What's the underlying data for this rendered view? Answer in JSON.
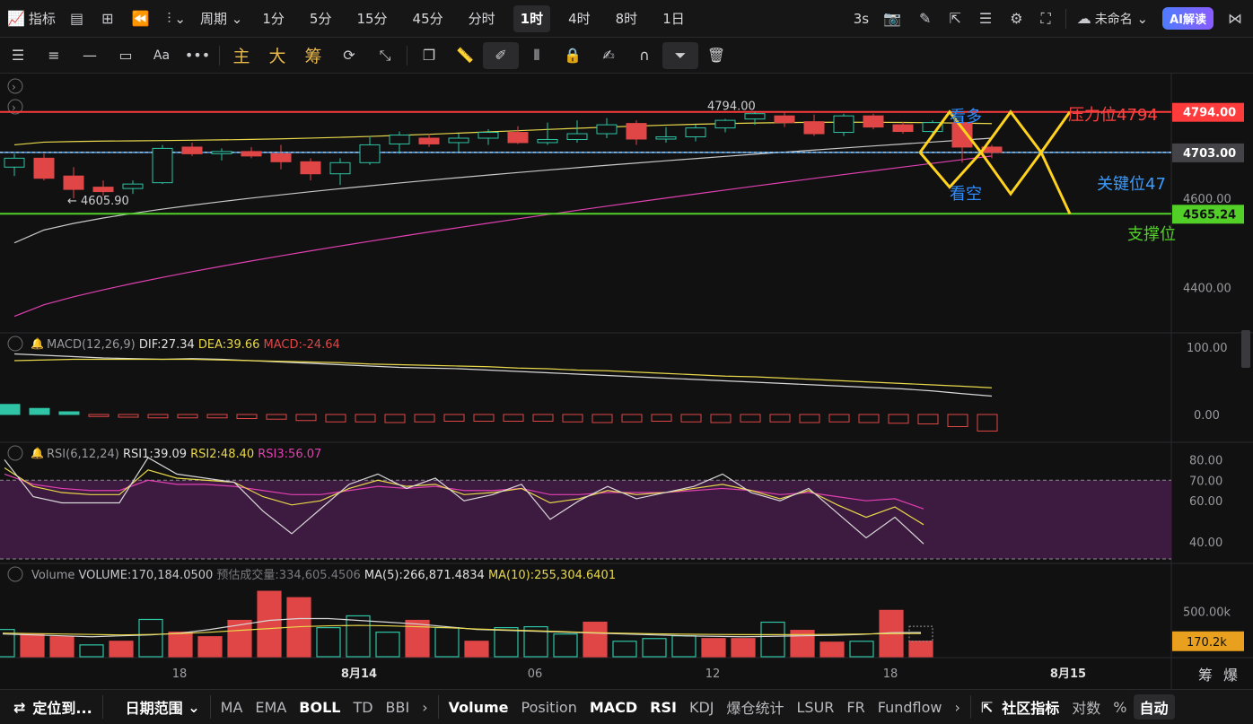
{
  "topbar": {
    "indicator_label": "指标",
    "period_label": "周期",
    "intervals": [
      "1分",
      "5分",
      "15分",
      "45分",
      "分时",
      "1时",
      "4时",
      "8时",
      "1日"
    ],
    "active_interval": "1时",
    "refresh_label": "3s",
    "workspace_name": "未命名",
    "ai_label": "AI解读"
  },
  "toolbar": {
    "main_label": "主",
    "big_label": "大",
    "chip_label": "筹"
  },
  "colors": {
    "up": "#2ec4a5",
    "down": "#e04646",
    "ma_yellow": "#e8d84a",
    "ma_white": "#c8c8c8",
    "ma_pink": "#e040b0",
    "resistance": "#ff3b3b",
    "support": "#52d028",
    "key": "#4aa8ff",
    "zigzag": "#ffd21e",
    "annotation_blue": "#2e8cff"
  },
  "chart_data": [
    {
      "type": "candlestick",
      "panel": "price",
      "y_axis_ticks": [
        4600,
        4400
      ],
      "price_tags": [
        4794.0,
        4703.0,
        4565.24
      ],
      "high_label": "4794.00",
      "low_label": "← 4605.90",
      "candles": [
        {
          "o": 4670,
          "h": 4700,
          "l": 4650,
          "c": 4690
        },
        {
          "o": 4690,
          "h": 4700,
          "l": 4640,
          "c": 4645
        },
        {
          "o": 4650,
          "h": 4670,
          "l": 4600,
          "c": 4620
        },
        {
          "o": 4625,
          "h": 4640,
          "l": 4605.9,
          "c": 4615
        },
        {
          "o": 4622,
          "h": 4640,
          "l": 4610,
          "c": 4632
        },
        {
          "o": 4635,
          "h": 4720,
          "l": 4632,
          "c": 4712
        },
        {
          "o": 4715,
          "h": 4725,
          "l": 4695,
          "c": 4700
        },
        {
          "o": 4700,
          "h": 4712,
          "l": 4685,
          "c": 4705
        },
        {
          "o": 4705,
          "h": 4715,
          "l": 4690,
          "c": 4695
        },
        {
          "o": 4700,
          "h": 4720,
          "l": 4665,
          "c": 4682
        },
        {
          "o": 4682,
          "h": 4690,
          "l": 4640,
          "c": 4655
        },
        {
          "o": 4655,
          "h": 4690,
          "l": 4630,
          "c": 4680
        },
        {
          "o": 4680,
          "h": 4740,
          "l": 4675,
          "c": 4720
        },
        {
          "o": 4722,
          "h": 4750,
          "l": 4700,
          "c": 4742
        },
        {
          "o": 4735,
          "h": 4745,
          "l": 4715,
          "c": 4722
        },
        {
          "o": 4725,
          "h": 4745,
          "l": 4705,
          "c": 4735
        },
        {
          "o": 4735,
          "h": 4755,
          "l": 4720,
          "c": 4748
        },
        {
          "o": 4748,
          "h": 4762,
          "l": 4722,
          "c": 4725
        },
        {
          "o": 4725,
          "h": 4770,
          "l": 4720,
          "c": 4732
        },
        {
          "o": 4732,
          "h": 4775,
          "l": 4725,
          "c": 4745
        },
        {
          "o": 4745,
          "h": 4780,
          "l": 4735,
          "c": 4765
        },
        {
          "o": 4768,
          "h": 4775,
          "l": 4720,
          "c": 4733
        },
        {
          "o": 4733,
          "h": 4760,
          "l": 4725,
          "c": 4738
        },
        {
          "o": 4738,
          "h": 4765,
          "l": 4728,
          "c": 4758
        },
        {
          "o": 4758,
          "h": 4778,
          "l": 4748,
          "c": 4775
        },
        {
          "o": 4778,
          "h": 4794,
          "l": 4765,
          "c": 4790
        },
        {
          "o": 4785,
          "h": 4794,
          "l": 4760,
          "c": 4770
        },
        {
          "o": 4772,
          "h": 4788,
          "l": 4740,
          "c": 4745
        },
        {
          "o": 4748,
          "h": 4790,
          "l": 4740,
          "c": 4785
        },
        {
          "o": 4785,
          "h": 4790,
          "l": 4755,
          "c": 4760
        },
        {
          "o": 4765,
          "h": 4772,
          "l": 4745,
          "c": 4750
        },
        {
          "o": 4750,
          "h": 4775,
          "l": 4740,
          "c": 4770
        },
        {
          "o": 4770,
          "h": 4780,
          "l": 4680,
          "c": 4715
        },
        {
          "o": 4715,
          "h": 4720,
          "l": 4690,
          "c": 4703
        }
      ],
      "levels": {
        "resistance": 4794.0,
        "key": 4703.0,
        "support": 4565.24
      },
      "annotations": {
        "bull": "看多",
        "bear": "看空",
        "resistance_text": "压力位4794",
        "key_text": "关键位47",
        "support_text": "支撑位"
      }
    },
    {
      "type": "bar+line",
      "panel": "macd",
      "title": "MACD(12,26,9)",
      "dif_label": "DIF:27.34",
      "dea_label": "DEA:39.66",
      "macd_label": "MACD:-24.64",
      "y_axis_ticks": [
        "100.00",
        "0.00"
      ],
      "hist": [
        15,
        9,
        4,
        -3,
        -4,
        -5,
        -5,
        -5,
        -6,
        -7,
        -9,
        -11,
        -11,
        -12,
        -11,
        -10,
        -10,
        -10,
        -10,
        -11,
        -12,
        -11,
        -10,
        -11,
        -12,
        -11,
        -11,
        -12,
        -11,
        -12,
        -13,
        -14,
        -18,
        -24.64
      ],
      "dif": [
        90,
        88,
        86,
        84,
        83,
        82,
        83,
        82,
        80,
        78,
        76,
        74,
        72,
        70,
        69,
        68,
        66,
        64,
        62,
        60,
        58,
        56,
        54,
        52,
        50,
        48,
        46,
        44,
        42,
        40,
        38,
        35,
        31,
        27.34
      ],
      "dea": [
        80,
        81,
        82,
        82,
        82,
        82,
        82,
        81,
        80,
        79,
        78,
        77,
        75,
        74,
        73,
        72,
        71,
        69,
        68,
        66,
        65,
        63,
        61,
        59,
        57,
        56,
        54,
        52,
        50,
        48,
        46,
        44,
        42,
        39.66
      ]
    },
    {
      "type": "line",
      "panel": "rsi",
      "title": "RSI(6,12,24)",
      "rsi1_label": "RSI1:39.09",
      "rsi2_label": "RSI2:48.40",
      "rsi3_label": "RSI3:56.07",
      "y_axis_ticks": [
        "80.00",
        "70.00",
        "60.00",
        "40.00"
      ],
      "rsi1": [
        80,
        62,
        59,
        59,
        59,
        81,
        73,
        71,
        69,
        55,
        44,
        56,
        68,
        73,
        66,
        71,
        60,
        63,
        68,
        51,
        60,
        67,
        61,
        64,
        67,
        73,
        64,
        60,
        66,
        54,
        42,
        52,
        39.09
      ],
      "rsi2": [
        76,
        67,
        64,
        63,
        63,
        75,
        71,
        70,
        69,
        62,
        58,
        60,
        66,
        70,
        67,
        68,
        63,
        64,
        66,
        59,
        61,
        65,
        63,
        64,
        66,
        68,
        65,
        61,
        65,
        58,
        52,
        57,
        48.4
      ],
      "rsi3": [
        73,
        68,
        66,
        65,
        65,
        70,
        68,
        68,
        67,
        65,
        63,
        63,
        65,
        67,
        66,
        67,
        65,
        65,
        66,
        63,
        63,
        64,
        64,
        64,
        65,
        66,
        65,
        63,
        64,
        62,
        60,
        61,
        56.07
      ]
    },
    {
      "type": "bar+line",
      "panel": "volume",
      "title": "Volume",
      "volume_label": "VOLUME:170,184.0500",
      "est_label": "预估成交量:334,605.4506",
      "ma5_label": "MA(5):266,871.4834",
      "ma10_label": "MA(10):255,304.6401",
      "y_axis_ticks": [
        "500.00k"
      ],
      "current_tag": "170.2k",
      "volumes": [
        300000,
        250000,
        220000,
        130000,
        170000,
        410000,
        270000,
        220000,
        400000,
        720000,
        650000,
        320000,
        450000,
        270000,
        400000,
        320000,
        170000,
        320000,
        330000,
        250000,
        380000,
        170000,
        200000,
        230000,
        200000,
        200000,
        380000,
        290000,
        160000,
        170000,
        510000,
        170184
      ],
      "up_flags": [
        true,
        false,
        false,
        true,
        false,
        true,
        false,
        false,
        false,
        false,
        false,
        true,
        true,
        true,
        false,
        true,
        false,
        true,
        true,
        true,
        false,
        true,
        true,
        true,
        false,
        false,
        true,
        false,
        false,
        true,
        false,
        false
      ],
      "ma5": [
        250000,
        240000,
        230000,
        220000,
        230000,
        240000,
        260000,
        300000,
        350000,
        400000,
        420000,
        420000,
        400000,
        380000,
        360000,
        330000,
        300000,
        290000,
        280000,
        270000,
        260000,
        250000,
        240000,
        230000,
        225000,
        220000,
        225000,
        230000,
        235000,
        245000,
        265000,
        266871
      ],
      "ma10": [
        260000,
        255000,
        250000,
        245000,
        240000,
        245000,
        255000,
        270000,
        290000,
        310000,
        330000,
        340000,
        345000,
        340000,
        330000,
        320000,
        305000,
        295000,
        285000,
        275000,
        265000,
        258000,
        252000,
        248000,
        245000,
        243000,
        243000,
        244000,
        246000,
        250000,
        254000,
        255304
      ]
    }
  ],
  "x_axis_labels": [
    "18",
    "8月14",
    "06",
    "12",
    "18",
    "8月15"
  ],
  "x_axis_bold": [
    "8月14",
    "8月15"
  ],
  "corner_labels": {
    "chip": "筹",
    "burst": "爆"
  },
  "bottombar": {
    "locate": "定位到...",
    "date_range": "日期范围",
    "main_indicators": [
      "MA",
      "EMA",
      "BOLL",
      "TD",
      "BBI"
    ],
    "main_active": "BOLL",
    "sub_indicators": [
      "Volume",
      "Position",
      "MACD",
      "RSI",
      "KDJ",
      "爆仓统计",
      "LSUR",
      "FR",
      "Fundflow"
    ],
    "sub_active": [
      "Volume",
      "MACD",
      "RSI"
    ],
    "community": "社区指标",
    "log": "对数",
    "percent": "%",
    "auto": "自动"
  }
}
